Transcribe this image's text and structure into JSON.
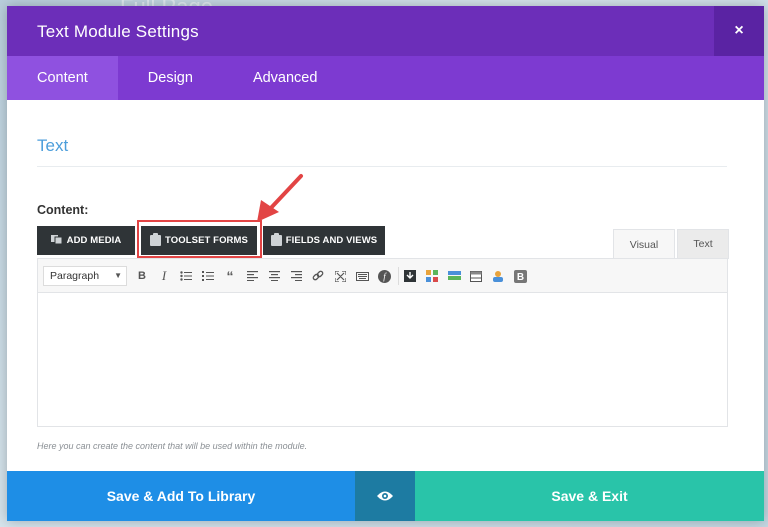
{
  "background": {
    "title": "Full Page"
  },
  "modal": {
    "title": "Text Module Settings",
    "close_label": "×",
    "tabs": [
      {
        "label": "Content",
        "active": true
      },
      {
        "label": "Design",
        "active": false
      },
      {
        "label": "Advanced",
        "active": false
      }
    ]
  },
  "section": {
    "title": "Text"
  },
  "content_field": {
    "label": "Content:",
    "media_buttons": [
      {
        "label": "ADD MEDIA",
        "icon": "add-media-icon"
      },
      {
        "label": "TOOLSET FORMS",
        "icon": "toolbox-icon"
      },
      {
        "label": "FIELDS AND VIEWS",
        "icon": "toolbox-icon"
      }
    ],
    "editor_tabs": [
      {
        "label": "Visual",
        "active": true
      },
      {
        "label": "Text",
        "active": false
      }
    ],
    "format_select": {
      "value": "Paragraph"
    },
    "toolbar_icons": [
      "bold-icon",
      "italic-icon",
      "bullet-list-icon",
      "numbered-list-icon",
      "blockquote-icon",
      "align-left-icon",
      "align-center-icon",
      "align-right-icon",
      "link-icon",
      "fullscreen-icon",
      "keyboard-icon",
      "formidable-icon",
      "download-icon",
      "grid-icon",
      "layout-icon",
      "table-icon",
      "user-icon",
      "bootstrap-icon"
    ],
    "help_text": "Here you can create the content that will be used within the module."
  },
  "footer": {
    "save_library_label": "Save & Add To Library",
    "save_exit_label": "Save & Exit",
    "preview_icon": "eye-icon"
  },
  "colors": {
    "header": "#6c2eb9",
    "tabs": "#7d3ad1",
    "active_tab": "#8f51e0",
    "library_button": "#1e8ee6",
    "preview_button": "#1d7ba2",
    "exit_button": "#29c4a9",
    "highlight": "#e24444"
  }
}
